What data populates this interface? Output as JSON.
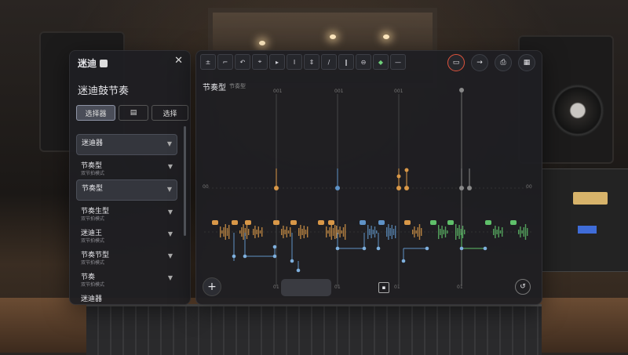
{
  "left_panel": {
    "title": "迷迪",
    "close_symbol": "✕",
    "heading": "迷迪鼓节奏",
    "buttons": [
      "选择器",
      "",
      "选择"
    ],
    "faded_top": "",
    "items": [
      {
        "name": "迷迪器",
        "sub": "",
        "highlight": true
      },
      {
        "name": "节奏型",
        "sub": "双节拍模式",
        "highlight": false
      },
      {
        "name": "节奏型",
        "sub": "",
        "highlight": true
      },
      {
        "name": "节奏生型",
        "sub": "双节拍模式",
        "highlight": false
      },
      {
        "name": "迷迪王",
        "sub": "双节拍模式",
        "highlight": false
      },
      {
        "name": "节奏节型",
        "sub": "双节拍模式",
        "highlight": false
      },
      {
        "name": "节奏",
        "sub": "双节拍模式",
        "highlight": false
      },
      {
        "name": "迷迪器",
        "sub": "",
        "highlight": false
      }
    ]
  },
  "main_panel": {
    "toolbar_icons": [
      "±",
      "⌐",
      "↶",
      "⌖",
      "▸",
      "I",
      "⇕",
      "/",
      "‖",
      "⊖",
      "◆",
      "—"
    ],
    "right_icons": [
      "rec-icon",
      "arrow-right-icon",
      "save-icon",
      "grid-icon"
    ],
    "track_title": "节奏型",
    "track_sub": "节奏型",
    "top_labels": [
      "001",
      "001",
      "001"
    ],
    "bottom_labels": [
      "01",
      "01",
      "01",
      "01"
    ],
    "side_labels": [
      "00",
      "00"
    ]
  },
  "colors": {
    "accent_purple": "#8b6fd6",
    "accent_teal": "#4fb3a6",
    "accent_green": "#5fc06a",
    "accent_orange": "#d99848",
    "accent_blue": "#5f93c7",
    "rec_red": "#e0533c"
  }
}
